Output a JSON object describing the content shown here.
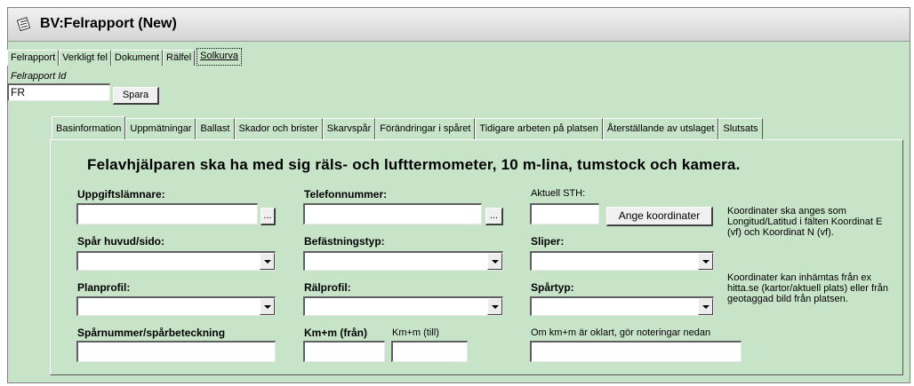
{
  "window": {
    "title": "BV:Felrapport (New)"
  },
  "top_tabs": [
    {
      "label": "Felrapport",
      "selected": false
    },
    {
      "label": "Verkligt fel",
      "selected": false
    },
    {
      "label": "Dokument",
      "selected": false
    },
    {
      "label": "Rälfel",
      "selected": false
    },
    {
      "label": "Solkurva",
      "selected": true
    }
  ],
  "report": {
    "id_label": "Felrapport Id",
    "id_value": "FR",
    "save_label": "Spara"
  },
  "inner_tabs": [
    {
      "label": "Basinformation",
      "selected": true
    },
    {
      "label": "Uppmätningar",
      "selected": false
    },
    {
      "label": "Ballast",
      "selected": false
    },
    {
      "label": "Skador och brister",
      "selected": false
    },
    {
      "label": "Skarvspår",
      "selected": false
    },
    {
      "label": "Förändringar i spåret",
      "selected": false
    },
    {
      "label": "Tidigare arbeten på platsen",
      "selected": false
    },
    {
      "label": "Återställande av utslaget",
      "selected": false
    },
    {
      "label": "Slutsats",
      "selected": false
    }
  ],
  "form": {
    "heading": "Felavhjälparen ska ha med sig räls- och lufttermometer, 10 m-lina, tumstock och kamera.",
    "uppgiftslamnare_label": "Uppgiftslämnare:",
    "telefonnummer_label": "Telefonnummer:",
    "aktuell_sth_label": "Aktuell STH:",
    "ange_koordinater_label": "Ange koordinater",
    "browse_label": "...",
    "spar_label": "Spår huvud/sido:",
    "befastningstyp_label": "Befästningstyp:",
    "sliper_label": "Sliper:",
    "planprofil_label": "Planprofil:",
    "ralprofil_label": "Rälprofil:",
    "spartyp_label": "Spårtyp:",
    "sparnummer_label": "Spårnummer/spårbeteckning",
    "km_fran_label": "Km+m (från)",
    "km_till_label": "Km+m (till)",
    "km_note_label": "Om km+m är oklart, gör noteringar nedan",
    "coord_note_1": "Koordinater ska anges som Longitud/Latitud i fälten Koordinat E (vf) och Koordinat N (vf).",
    "coord_note_2": "Koordinater kan inhämtas från ex hitta.se (kartor/aktuell plats) eller från geotaggad bild från platsen."
  }
}
